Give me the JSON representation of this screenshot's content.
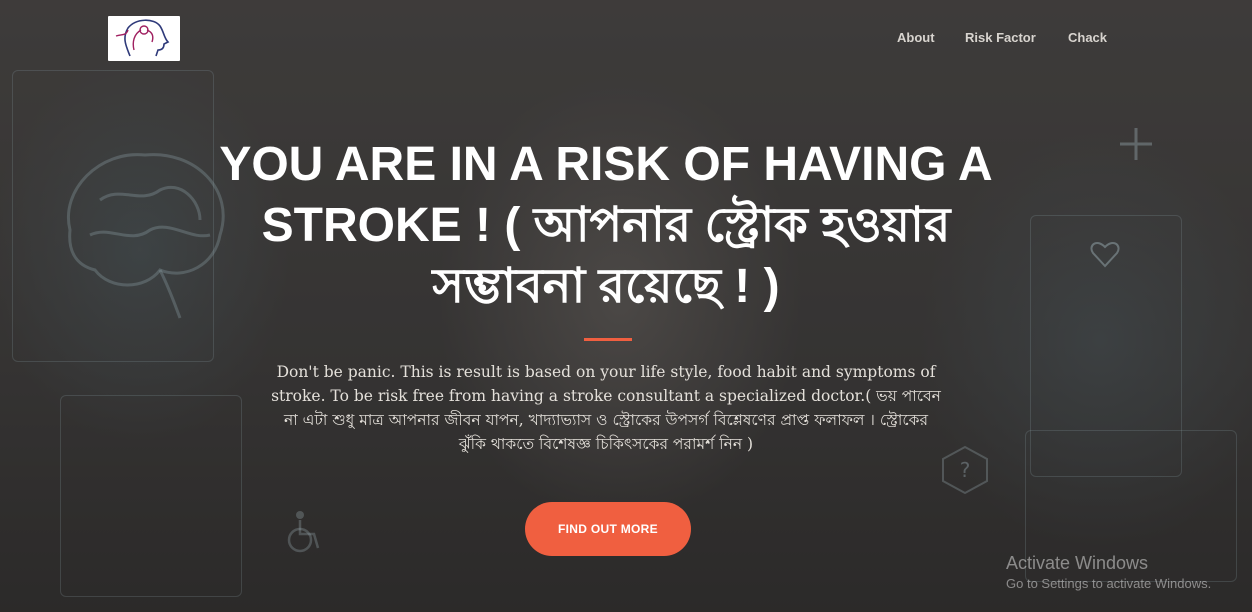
{
  "nav": {
    "logo_icon": "head-brain-icon",
    "links": [
      "About",
      "Risk Factor",
      "Chack"
    ]
  },
  "hero": {
    "headline": "YOU ARE IN A RISK OF HAVING A STROKE ! ( আপনার স্ট্রোক হওয়ার সম্ভাবনা রয়েছে ! )",
    "subtext": "Don't be panic. This is result is based on your life style, food habit and symptoms of stroke. To be risk free from having a stroke consultant a specialized doctor.( ভয় পাবেন না এটা শুধু মাত্র আপনার জীবন যাপন, খাদ্যাভ্যাস ও স্ট্রোকের উপসর্গ বিশ্লেষণের প্রাপ্ত ফলাফল । স্ট্রোকের ঝুঁকি থাকতে বিশেষজ্ঞ চিকিৎসকের পরামর্শ নিন )",
    "button_label": "FIND OUT MORE",
    "accent_color": "#f05f40"
  },
  "windows_watermark": {
    "title": "Activate Windows",
    "subtitle": "Go to Settings to activate Windows."
  }
}
